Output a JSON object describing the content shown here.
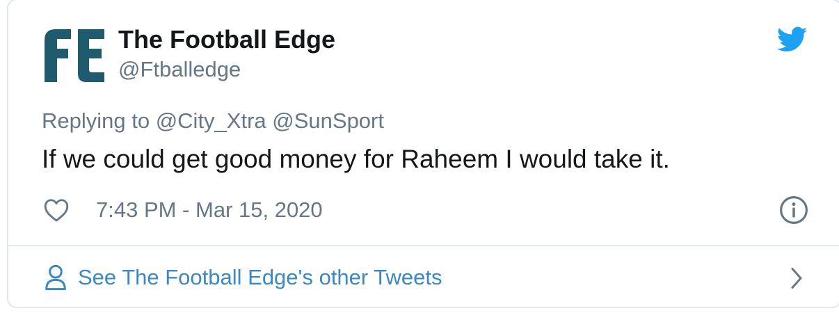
{
  "tweet": {
    "author": {
      "display_name": "The Football Edge",
      "handle": "@Ftballedge",
      "avatar_letters": "FE"
    },
    "reply_line": "Replying to @City_Xtra @SunSport",
    "text": "If we could get good money for Raheem I would take it.",
    "timestamp": "7:43 PM - Mar 15, 2020"
  },
  "footer": {
    "link_label": "See The Football Edge's other Tweets"
  },
  "icons": {
    "bird": "twitter-bird-icon",
    "heart": "heart-icon",
    "info": "info-icon",
    "person": "person-icon",
    "chevron": "chevron-right-icon"
  },
  "colors": {
    "avatar": "#1f5a6e",
    "twitter_blue": "#1da1f2",
    "link_blue": "#3b88c3",
    "text": "#14171a",
    "secondary_text": "#657786",
    "border": "#e1e8ed"
  }
}
